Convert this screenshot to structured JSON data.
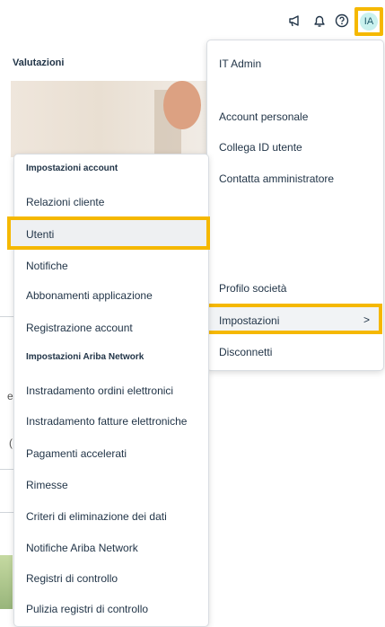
{
  "topbar": {
    "icons": [
      "megaphone-icon",
      "bell-icon",
      "help-icon"
    ],
    "avatar_initials": "IA",
    "colors": {
      "highlight": "#f5b800",
      "avatar_bg": "#c9f1ee"
    }
  },
  "page": {
    "title": "Valutazioni",
    "peek_e": "e",
    "peek_c": "("
  },
  "user_menu": {
    "user_name": "IT Admin",
    "items": [
      "Account personale",
      "Collega ID utente",
      "Contatta amministratore",
      "Profilo società",
      "Impostazioni",
      "Disconnetti"
    ],
    "chevron": ">"
  },
  "settings_menu": {
    "section_account": "Impostazioni account",
    "account_items": [
      "Relazioni cliente",
      "Utenti",
      "Notifiche",
      "Abbonamenti applicazione",
      "Registrazione account"
    ],
    "section_network": "Impostazioni Ariba Network",
    "network_items": [
      "Instradamento ordini elettronici",
      "Instradamento fatture elettroniche",
      "Pagamenti accelerati",
      "Rimesse",
      "Criteri di eliminazione dei dati",
      "Notifiche Ariba Network",
      "Registri di controllo",
      "Pulizia registri di controllo"
    ]
  }
}
